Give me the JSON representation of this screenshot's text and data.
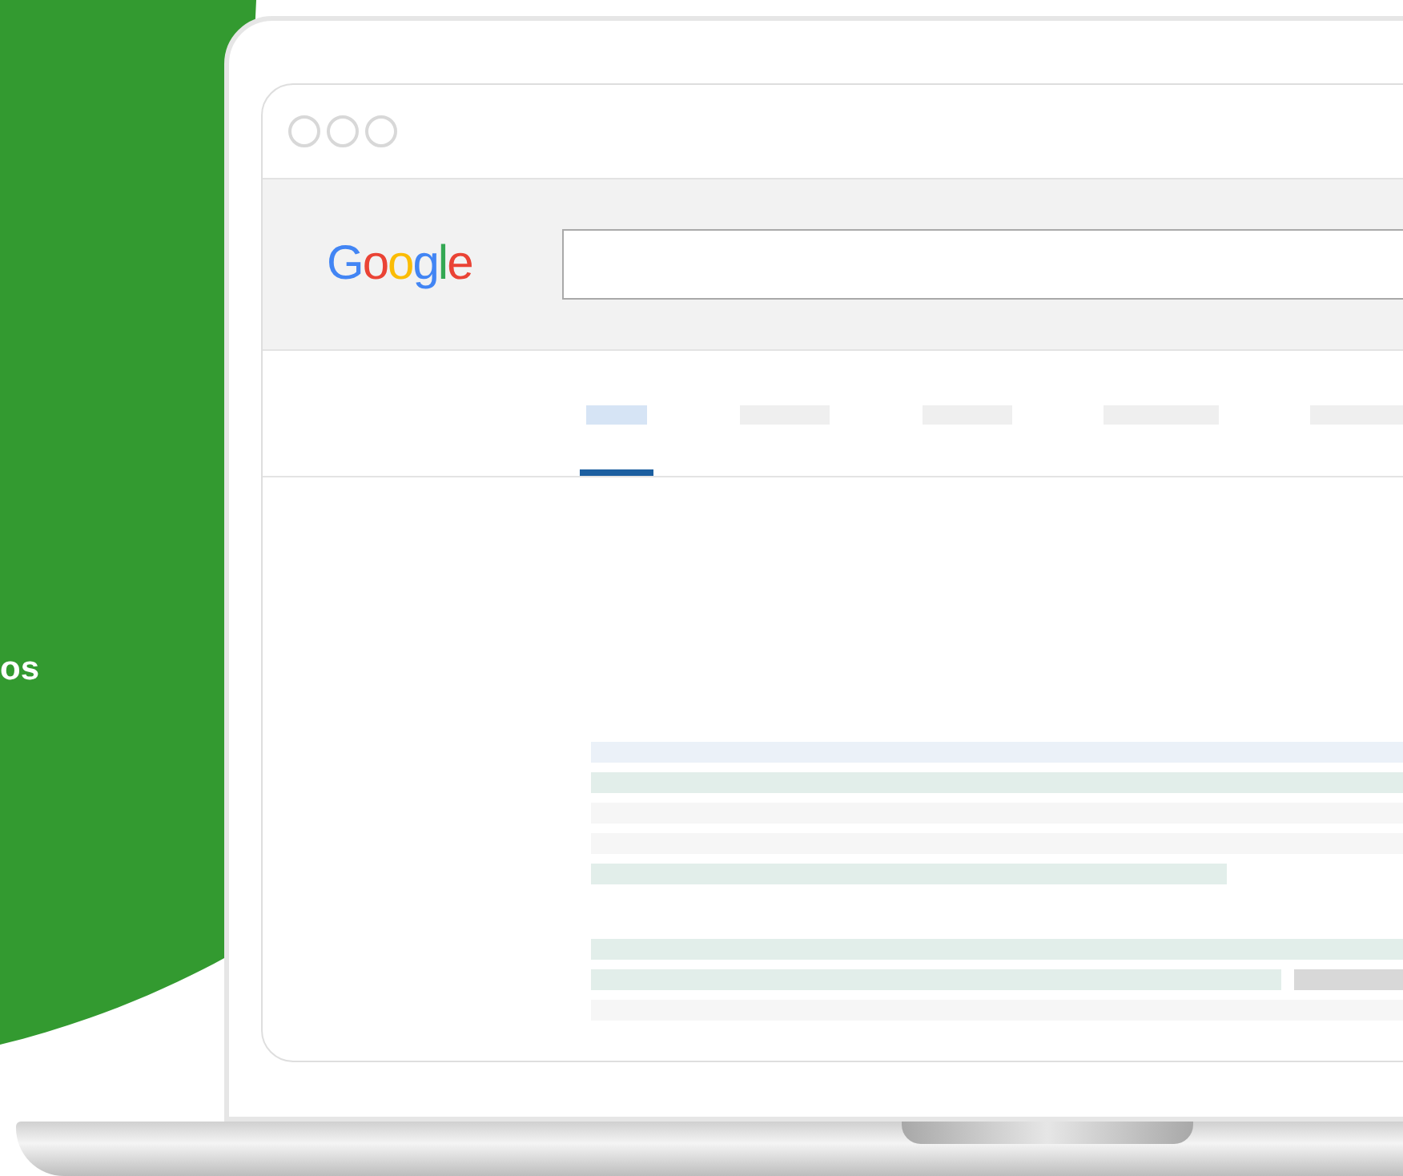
{
  "side_text": "os",
  "logo": {
    "text": "Google"
  },
  "tabs": [
    {
      "selected": true
    },
    {
      "selected": false
    },
    {
      "selected": false
    },
    {
      "selected": false
    },
    {
      "selected": false
    }
  ]
}
